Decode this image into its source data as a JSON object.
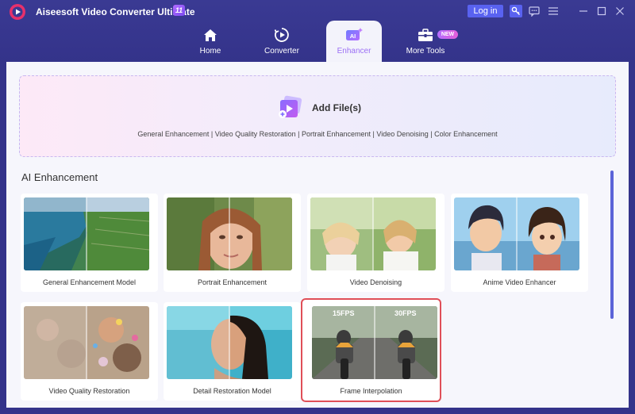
{
  "app": {
    "title": "Aiseesoft Video Converter Ultimate",
    "version_badge": "11"
  },
  "header": {
    "login_label": "Log in"
  },
  "tabs": [
    {
      "label": "Home",
      "icon": "home-icon"
    },
    {
      "label": "Converter",
      "icon": "converter-icon"
    },
    {
      "label": "Enhancer",
      "icon": "ai-enhancer-icon",
      "icon_text": "AI"
    },
    {
      "label": "More Tools",
      "icon": "toolbox-icon",
      "badge": "NEW"
    }
  ],
  "add_files": {
    "label": "Add File(s)",
    "categories": "General Enhancement | Video Quality Restoration | Portrait Enhancement | Video Denoising | Color Enhancement"
  },
  "section": {
    "title": "AI Enhancement"
  },
  "cards": [
    {
      "label": "General Enhancement Model"
    },
    {
      "label": "Portrait Enhancement"
    },
    {
      "label": "Video Denoising"
    },
    {
      "label": "Anime Video Enhancer"
    },
    {
      "label": "Video Quality Restoration"
    },
    {
      "label": "Detail Restoration Model"
    },
    {
      "label": "Frame Interpolation",
      "fps_left": "15FPS",
      "fps_right": "30FPS",
      "selected": true
    }
  ],
  "colors": {
    "header": "#34338a",
    "accent": "#5962f0",
    "active_tab_text": "#9b6ff5",
    "selection": "#e04f58"
  }
}
